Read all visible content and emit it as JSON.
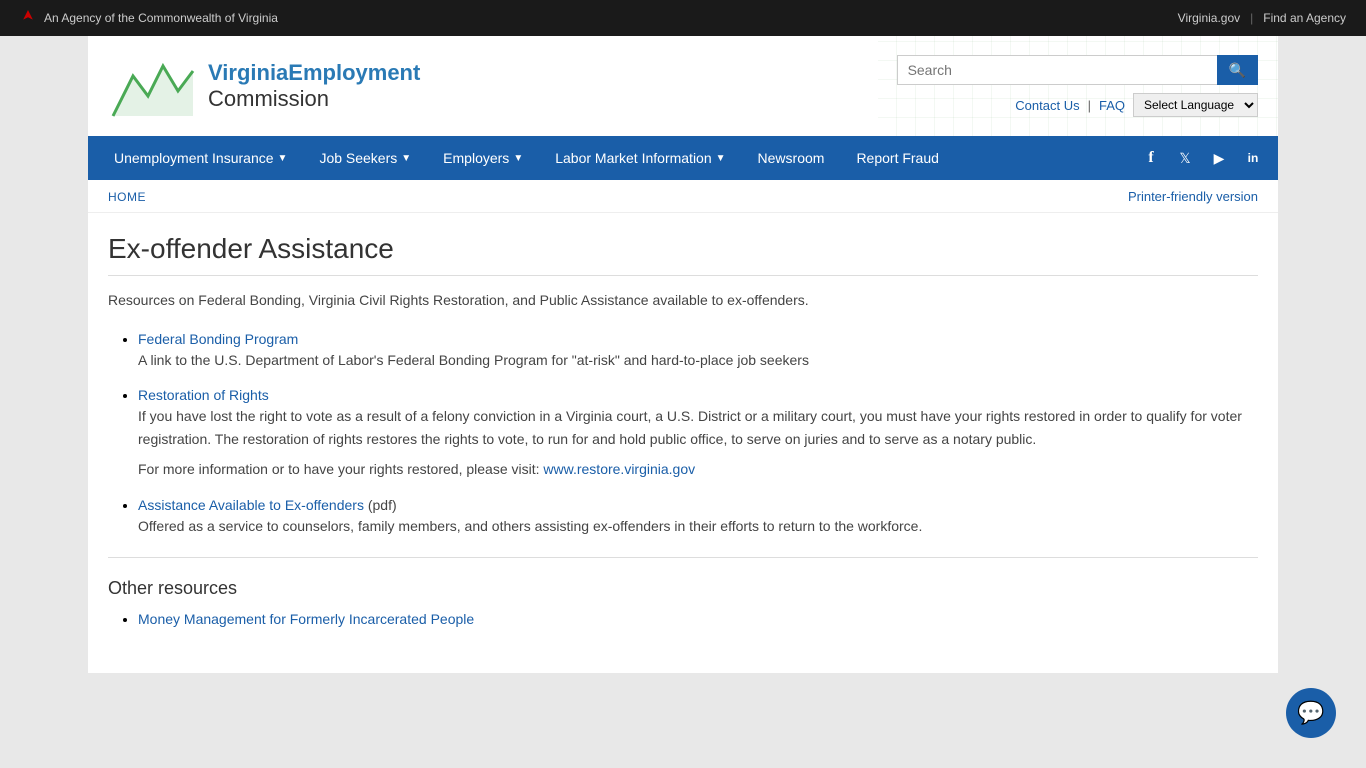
{
  "topbar": {
    "agency_text": "An Agency of the Commonwealth of Virginia",
    "virginia_gov": "Virginia.gov",
    "find_agency": "Find an Agency"
  },
  "header": {
    "logo_line1": "Virginia",
    "logo_line2": "Employment",
    "logo_line3": "Commission",
    "search_placeholder": "Search",
    "contact_us": "Contact Us",
    "faq": "FAQ",
    "language_label": "Select Language"
  },
  "nav": {
    "items": [
      {
        "label": "Unemployment Insurance",
        "has_arrow": true
      },
      {
        "label": "Job Seekers",
        "has_arrow": true
      },
      {
        "label": "Employers",
        "has_arrow": true
      },
      {
        "label": "Labor Market Information",
        "has_arrow": true
      },
      {
        "label": "Newsroom",
        "has_arrow": false
      },
      {
        "label": "Report Fraud",
        "has_arrow": false
      }
    ],
    "social": [
      {
        "icon": "f",
        "name": "facebook"
      },
      {
        "icon": "t",
        "name": "twitter"
      },
      {
        "icon": "▶",
        "name": "youtube"
      },
      {
        "icon": "in",
        "name": "linkedin"
      }
    ]
  },
  "breadcrumb": {
    "home": "HOME",
    "printer": "Printer-friendly version"
  },
  "page": {
    "title": "Ex-offender Assistance",
    "intro": "Resources on Federal Bonding, Virginia Civil Rights Restoration, and Public Assistance available to ex-offenders.",
    "resources": [
      {
        "link_text": "Federal Bonding Program",
        "desc": "A link to the U.S. Department of Labor's Federal Bonding Program for \"at-risk\" and hard-to-place job seekers",
        "extra": ""
      },
      {
        "link_text": "Restoration of Rights",
        "desc": "If you have lost the right to vote as a result of a felony conviction in a Virginia court, a U.S. District or a military court, you must have your rights restored in order to qualify for voter registration. The restoration of rights restores the rights to vote, to run for and hold public office, to serve on juries and to serve as a notary public.",
        "extra": "For more information or to have your rights restored, please visit: ",
        "extra_link": "www.restore.virginia.gov",
        "extra_href": "http://www.restore.virginia.gov"
      },
      {
        "link_text": "Assistance Available to Ex-offenders",
        "suffix": " (pdf)",
        "desc": "Offered as a service to counselors, family members, and others assisting ex-offenders in their efforts to return to the workforce.",
        "extra": ""
      }
    ],
    "other_resources_title": "Other resources",
    "other_resources": [
      {
        "link_text": "Money Management for Formerly Incarcerated People",
        "desc": ""
      }
    ]
  }
}
